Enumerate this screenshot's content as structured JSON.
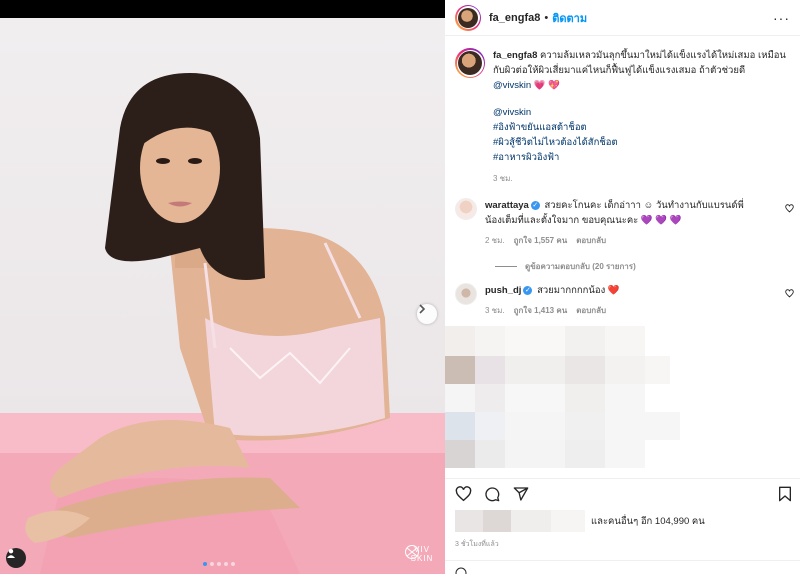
{
  "post": {
    "username": "fa_engfa8",
    "follow_label": "ติดตาม",
    "separator": "•",
    "more_label": "···"
  },
  "media": {
    "brand_text": "VIV SKIN",
    "carousel_dots": 5,
    "active_dot": 0,
    "colors": {
      "backdrop": "#efebed",
      "pink_table": "#f4a9b8",
      "hair": "#2c1f1a",
      "skin": "#e2b394"
    }
  },
  "caption": {
    "username": "fa_engfa8",
    "text": "ความล้มเหลวมันลุกขึ้นมาใหม่ได้แข็งแรงได้ใหม่เสมอ เหมือนกับผิวต่อให้ผิวเสี่ยมาแค่ไหนก็ฟื้นฟูได้แข็งแรงเสมอ ถ้าตัวช่วยดี",
    "mention": "@vivskin",
    "emojis": "💗 💖",
    "mention2": "@vivskin",
    "hashtags": [
      "#อิงฟ้าขยันแอสต้าช็อต",
      "#ผิวสู้ชีวิตไม่ไหวต้องได้สักช็อต",
      "#อาหารผิวอิงฟ้า"
    ],
    "time": "3 ชม."
  },
  "comments": [
    {
      "username": "warattaya",
      "text": "สวยคะโกนคะ เด็กอ่าาา ☺ วันทำงานกับแบรนด์พี่น้องเต็มที่และตั้งใจมาก ขอบคุณนะคะ 💜 💜 💜",
      "time": "2 ชม.",
      "likes": "ถูกใจ 1,557 คน",
      "reply": "ตอบกลับ"
    },
    {
      "username": "push_dj",
      "text": "สวยมากกกกน้อง ❤️",
      "time": "3 ชม.",
      "likes": "ถูกใจ 1,413 คน",
      "reply": "ตอบกลับ"
    }
  ],
  "view_replies": "ดูข้อความตอบกลับ (20 รายการ)",
  "likes_summary": "และคนอื่นๆ อีก 104,990 คน",
  "timestamp": "3 ชั่วโมงที่แล้ว",
  "icons": [
    "heart-icon",
    "comment-icon",
    "share-icon",
    "bookmark-icon",
    "next-arrow-icon",
    "user-tag-icon",
    "emoji-icon",
    "more-icon"
  ]
}
